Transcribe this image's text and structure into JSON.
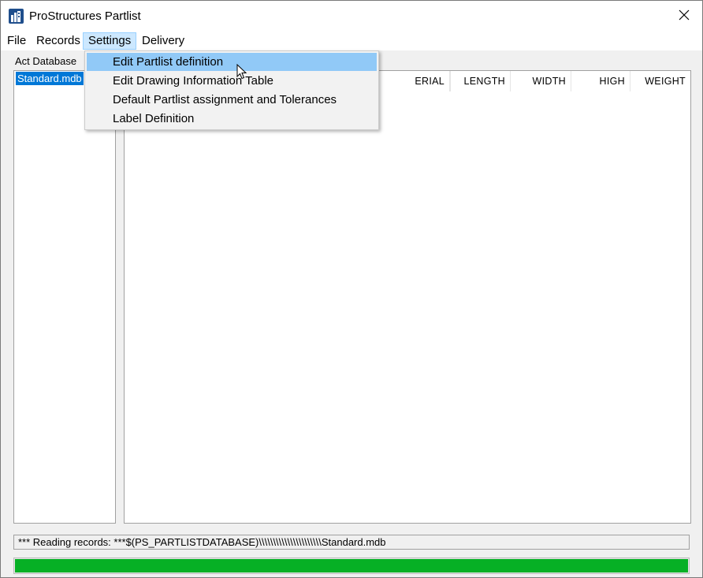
{
  "window": {
    "title": "ProStructures Partlist",
    "close_glyph": "✕"
  },
  "menubar": {
    "items": [
      {
        "label": "File"
      },
      {
        "label": "Records"
      },
      {
        "label": "Settings"
      },
      {
        "label": "Delivery"
      }
    ],
    "active": "Settings"
  },
  "settings_menu": {
    "items": [
      {
        "label": "Edit Partlist definition",
        "highlighted": true
      },
      {
        "label": "Edit Drawing Information Table"
      },
      {
        "label": "Default Partlist assignment and Tolerances"
      },
      {
        "label": "Label Definition"
      }
    ]
  },
  "left_panel": {
    "label": "Act Database",
    "items": [
      {
        "label": "Standard.mdb",
        "selected": true
      }
    ]
  },
  "table": {
    "columns": [
      "ERIAL",
      "LENGTH",
      "WIDTH",
      "HIGH",
      "WEIGHT"
    ]
  },
  "status": {
    "text": "*** Reading records: ***$(PS_PARTLISTDATABASE)\\\\\\\\\\\\\\\\\\\\\\\\\\\\\\\\\\\\\\\\\\\\Standard.mdb"
  },
  "progress": {
    "value_percent": 100,
    "color": "#06b025"
  },
  "colors": {
    "selection": "#0078d7",
    "menu_highlight": "#91c9f7",
    "menu_active": "#cce8ff"
  },
  "icons": {
    "app": "building-icon",
    "close": "close-icon",
    "cursor": "arrow-cursor-icon"
  }
}
